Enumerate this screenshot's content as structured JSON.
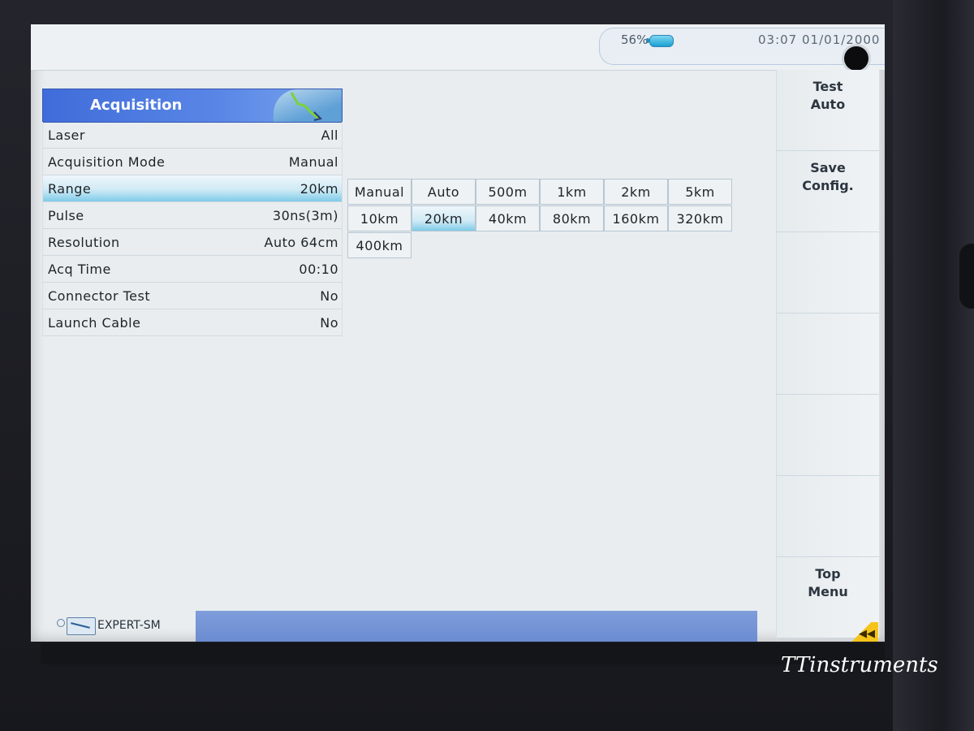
{
  "status": {
    "battery_percent": "56%",
    "time": "03:07",
    "date": "01/01/2000",
    "battery_icon": "battery-icon"
  },
  "panel": {
    "title": "Acquisition",
    "settings": [
      {
        "label": "Laser",
        "value": "All"
      },
      {
        "label": "Acquisition Mode",
        "value": "Manual"
      },
      {
        "label": "Range",
        "value": "20km",
        "selected": true
      },
      {
        "label": "Pulse",
        "value": "30ns(3m)"
      },
      {
        "label": "Resolution",
        "value": "Auto 64cm"
      },
      {
        "label": "Acq Time",
        "value": "00:10"
      },
      {
        "label": "Connector Test",
        "value": "No"
      },
      {
        "label": "Launch Cable",
        "value": "No"
      }
    ]
  },
  "range_options": {
    "selected": "20km",
    "rows": [
      [
        "Manual",
        "Auto",
        "500m",
        "1km",
        "2km",
        "5km"
      ],
      [
        "10km",
        "20km",
        "40km",
        "80km",
        "160km",
        "320km"
      ],
      [
        "400km"
      ]
    ]
  },
  "softkeys": [
    {
      "line1": "Test",
      "line2": "Auto"
    },
    {
      "line1": "Save",
      "line2": "Config."
    },
    {
      "line1": "",
      "line2": ""
    },
    {
      "line1": "",
      "line2": ""
    },
    {
      "line1": "",
      "line2": ""
    },
    {
      "line1": "",
      "line2": ""
    },
    {
      "line1": "Top",
      "line2": "Menu"
    }
  ],
  "bottombar": {
    "mode_label": "EXPERT-SM",
    "back_icon": "double-chevron-left-icon",
    "back_glyph": "◀◀"
  },
  "watermark": "TTinstruments",
  "colors": {
    "header_blue": "#4a78dd",
    "selection_cyan": "#7fcbe8",
    "progress_blue": "#6b8cd2",
    "screen_bg": "#e9edef"
  }
}
